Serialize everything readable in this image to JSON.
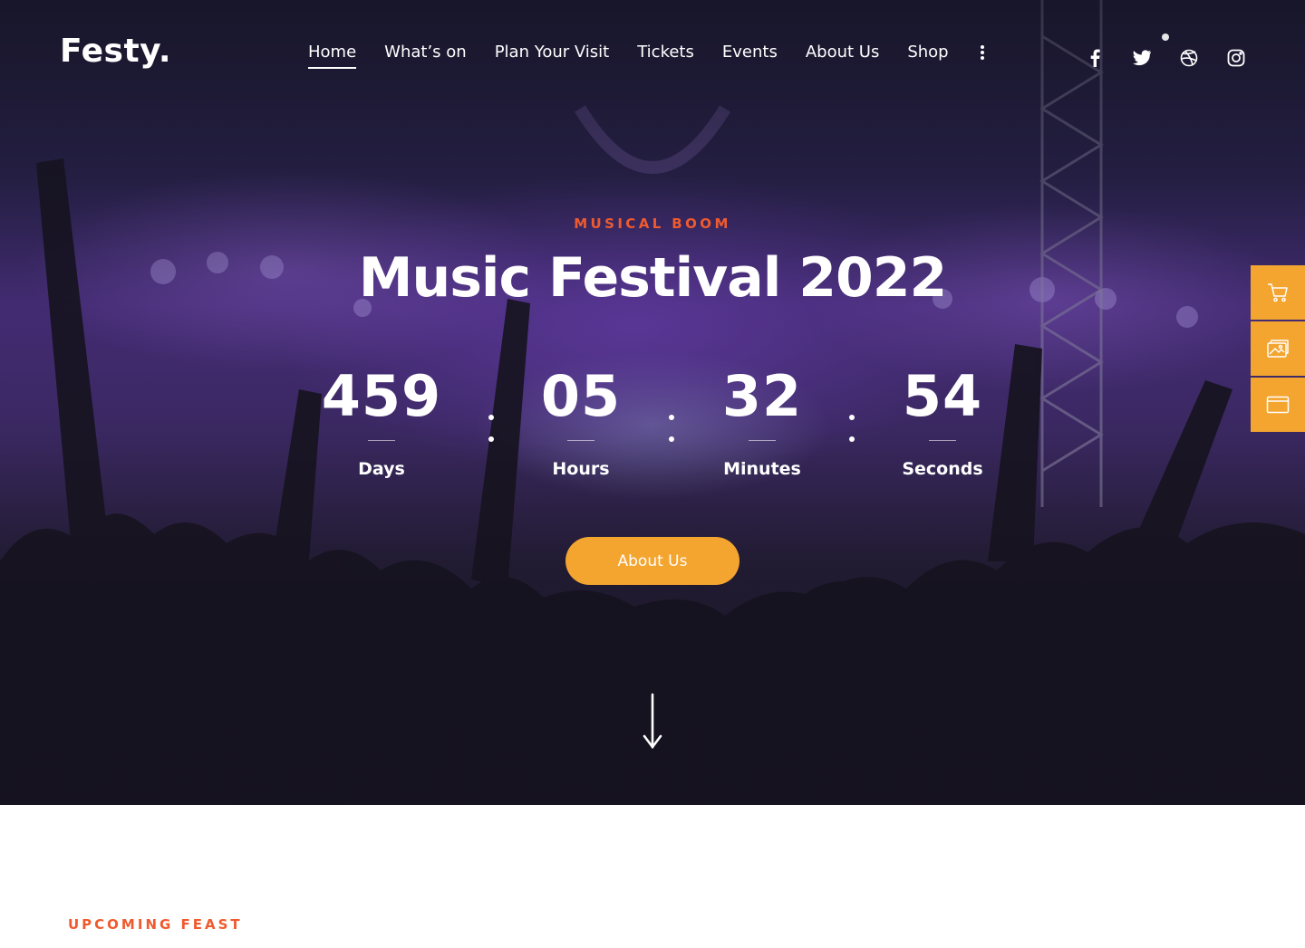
{
  "brand": {
    "logo": "Festy."
  },
  "nav": {
    "items": [
      {
        "label": "Home",
        "active": true
      },
      {
        "label": "What’s on"
      },
      {
        "label": "Plan Your Visit"
      },
      {
        "label": "Tickets"
      },
      {
        "label": "Events"
      },
      {
        "label": "About Us"
      },
      {
        "label": "Shop"
      }
    ],
    "more_icon": "vertical-dots-icon"
  },
  "social": [
    "facebook-icon",
    "twitter-icon",
    "dribbble-icon",
    "instagram-icon"
  ],
  "hero": {
    "eyebrow": "MUSICAL BOOM",
    "title": "Music Festival 2022",
    "countdown": [
      {
        "value": "459",
        "label": "Days"
      },
      {
        "value": "05",
        "label": "Hours"
      },
      {
        "value": "32",
        "label": "Minutes"
      },
      {
        "value": "54",
        "label": "Seconds"
      }
    ],
    "cta_label": "About Us",
    "scroll_icon": "arrow-down-icon"
  },
  "dock": [
    "cart-icon",
    "gallery-icon",
    "browser-window-icon"
  ],
  "colors": {
    "accent": "#f4a530",
    "eyebrow": "#ef5a2e",
    "hero_bg": "#2b2450"
  },
  "section": {
    "eyebrow": "UPCOMING FEAST"
  }
}
